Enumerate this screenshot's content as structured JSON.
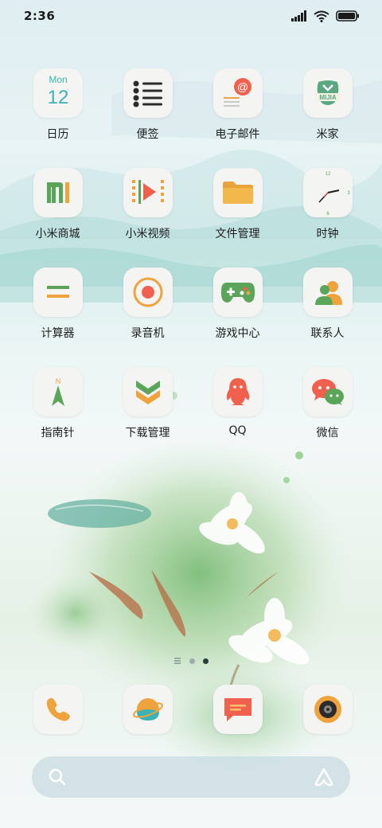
{
  "status_bar": {
    "time": "2:36",
    "icons": [
      "signal-icon",
      "wifi-icon",
      "battery-icon"
    ]
  },
  "apps": [
    {
      "label": "日历",
      "icon": "calendar-icon",
      "calendar_day": "Mon",
      "calendar_date": "12"
    },
    {
      "label": "便签",
      "icon": "notes-icon"
    },
    {
      "label": "电子邮件",
      "icon": "email-icon"
    },
    {
      "label": "米家",
      "icon": "mijia-icon",
      "icon_text": "MIJIA"
    },
    {
      "label": "小米商城",
      "icon": "mi-store-icon"
    },
    {
      "label": "小米视频",
      "icon": "video-icon"
    },
    {
      "label": "文件管理",
      "icon": "folder-icon"
    },
    {
      "label": "时钟",
      "icon": "clock-icon",
      "clock_numbers": [
        "12",
        "3",
        "6"
      ]
    },
    {
      "label": "计算器",
      "icon": "calculator-icon"
    },
    {
      "label": "录音机",
      "icon": "recorder-icon"
    },
    {
      "label": "游戏中心",
      "icon": "gamepad-icon"
    },
    {
      "label": "联系人",
      "icon": "contacts-icon"
    },
    {
      "label": "指南针",
      "icon": "compass-icon",
      "compass_letter": "N"
    },
    {
      "label": "下载管理",
      "icon": "download-icon"
    },
    {
      "label": "QQ",
      "icon": "qq-icon"
    },
    {
      "label": "微信",
      "icon": "wechat-icon"
    }
  ],
  "page_indicator": {
    "pages": 3,
    "current": 3
  },
  "dock": [
    {
      "icon": "phone-icon"
    },
    {
      "icon": "browser-icon"
    },
    {
      "icon": "messages-icon"
    },
    {
      "icon": "camera-icon"
    }
  ],
  "search_bar": {
    "left_icon": "search-icon",
    "right_icon": "assistant-icon"
  },
  "colors": {
    "accent_teal": "#3bb3b5",
    "accent_orange": "#f0a23c",
    "accent_red": "#f0604d",
    "accent_green": "#5ba55a"
  }
}
